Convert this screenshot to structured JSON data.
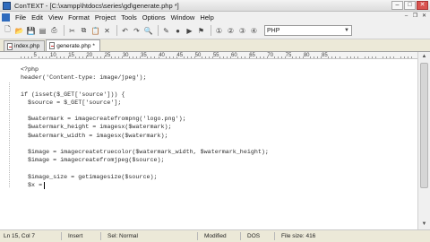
{
  "window": {
    "title": "ConTEXT - [C:\\xampp\\htdocs\\series\\gd\\generate.php *]"
  },
  "menu": {
    "items": [
      "File",
      "Edit",
      "View",
      "Format",
      "Project",
      "Tools",
      "Options",
      "Window",
      "Help"
    ]
  },
  "toolbar": {
    "highlighter_value": "PHP"
  },
  "tabs": [
    {
      "label": "index.php",
      "active": false
    },
    {
      "label": "generate.php *",
      "active": true
    }
  ],
  "ruler": {
    "marks": [
      "5",
      "10",
      "15",
      "20",
      "25",
      "30",
      "35",
      "40",
      "45",
      "50",
      "55",
      "60",
      "65",
      "70",
      "75",
      "80",
      "85"
    ]
  },
  "editor": {
    "lines": [
      "<?php",
      "header('Content-type: image/jpeg');",
      "",
      "if (isset($_GET['source'])) {",
      "  $source = $_GET['source'];",
      "",
      "  $watermark = imagecreatefrompng('logo.png');",
      "  $watermark_height = imagesx($watermark);",
      "  $watermark_width = imagesx($watermark);",
      "",
      "  $image = imagecreatetruecolor($watermark_width, $watermark_height);",
      "  $image = imagecreatefromjpeg($source);",
      "",
      "  $image_size = getimagesize($source);",
      "  $x ="
    ]
  },
  "status": {
    "position": "Ln 15, Col 7",
    "insert_mode": "Insert",
    "selection_mode": "Sel: Normal",
    "modified": "Modified",
    "line_endings": "DOS",
    "file_size": "File size: 416"
  }
}
